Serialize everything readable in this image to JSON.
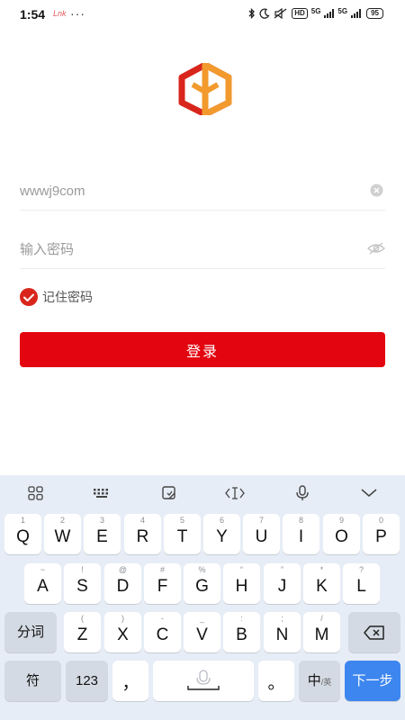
{
  "status_bar": {
    "time": "1:54",
    "notification_text": "Lnk",
    "more_indicator": "···",
    "hd_badge": "HD",
    "signal_1": "5G",
    "signal_2": "5G",
    "battery": "95",
    "icons": [
      "bluetooth-icon",
      "moon-icon",
      "mute-icon",
      "hd-icon",
      "signal-icon",
      "signal-icon",
      "battery-icon"
    ]
  },
  "logo": {
    "colors": {
      "red": "#d9261c",
      "orange": "#f29a2e"
    }
  },
  "login_form": {
    "username_value": "wwwj9com",
    "password_placeholder": "输入密码",
    "remember_label": "记住密码",
    "remember_checked": true,
    "login_button": "登录"
  },
  "colors": {
    "accent": "#e3050f",
    "keyboard_bg": "#e7edf6",
    "enter_key": "#3d86ef"
  },
  "keyboard": {
    "toolbar": [
      "grid-icon",
      "keyboard-icon",
      "clipboard-icon",
      "cursor-icon",
      "mic-icon",
      "collapse-icon"
    ],
    "row1": [
      {
        "hint": "1",
        "key": "Q"
      },
      {
        "hint": "2",
        "key": "W"
      },
      {
        "hint": "3",
        "key": "E"
      },
      {
        "hint": "4",
        "key": "R"
      },
      {
        "hint": "5",
        "key": "T"
      },
      {
        "hint": "6",
        "key": "Y"
      },
      {
        "hint": "7",
        "key": "U"
      },
      {
        "hint": "8",
        "key": "I"
      },
      {
        "hint": "9",
        "key": "O"
      },
      {
        "hint": "0",
        "key": "P"
      }
    ],
    "row2": [
      {
        "hint": "~",
        "key": "A"
      },
      {
        "hint": "!",
        "key": "S"
      },
      {
        "hint": "@",
        "key": "D"
      },
      {
        "hint": "#",
        "key": "F"
      },
      {
        "hint": "%",
        "key": "G"
      },
      {
        "hint": "“",
        "key": "H"
      },
      {
        "hint": "”",
        "key": "J"
      },
      {
        "hint": "*",
        "key": "K"
      },
      {
        "hint": "?",
        "key": "L"
      }
    ],
    "row3": [
      {
        "hint": "(",
        "key": "Z"
      },
      {
        "hint": ")",
        "key": "X"
      },
      {
        "hint": "-",
        "key": "C"
      },
      {
        "hint": "_",
        "key": "V"
      },
      {
        "hint": ":",
        "key": "B"
      },
      {
        "hint": ";",
        "key": "N"
      },
      {
        "hint": "/",
        "key": "M"
      }
    ],
    "segment_key": "分词",
    "symbol_key": "符",
    "number_key": "123",
    "comma_key": "，",
    "period_key": "。",
    "lang_key": "中",
    "lang_sub": "/英",
    "enter_key": "下一步"
  }
}
